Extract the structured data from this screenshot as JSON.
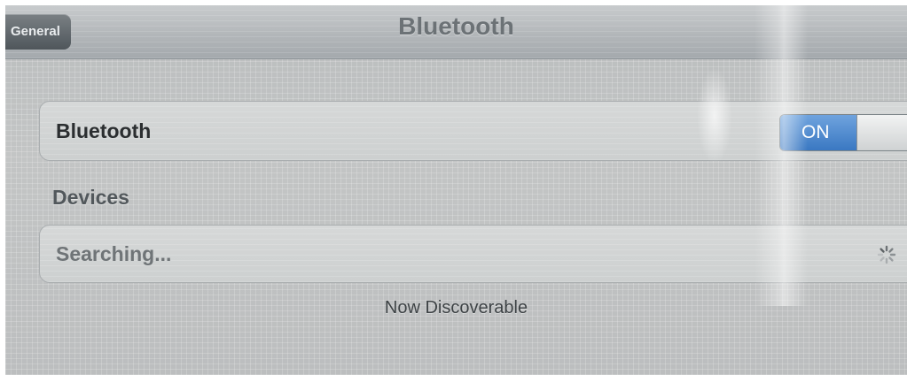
{
  "navbar": {
    "back_label": "General",
    "title": "Bluetooth"
  },
  "bluetooth_row": {
    "label": "Bluetooth",
    "toggle_label": "ON",
    "toggle_state": "on",
    "accent_color": "#3a78c2"
  },
  "devices_section": {
    "header": "Devices",
    "status_label": "Searching...",
    "spinner_icon": "activity-spinner-icon"
  },
  "footer": {
    "text": "Now Discoverable"
  }
}
